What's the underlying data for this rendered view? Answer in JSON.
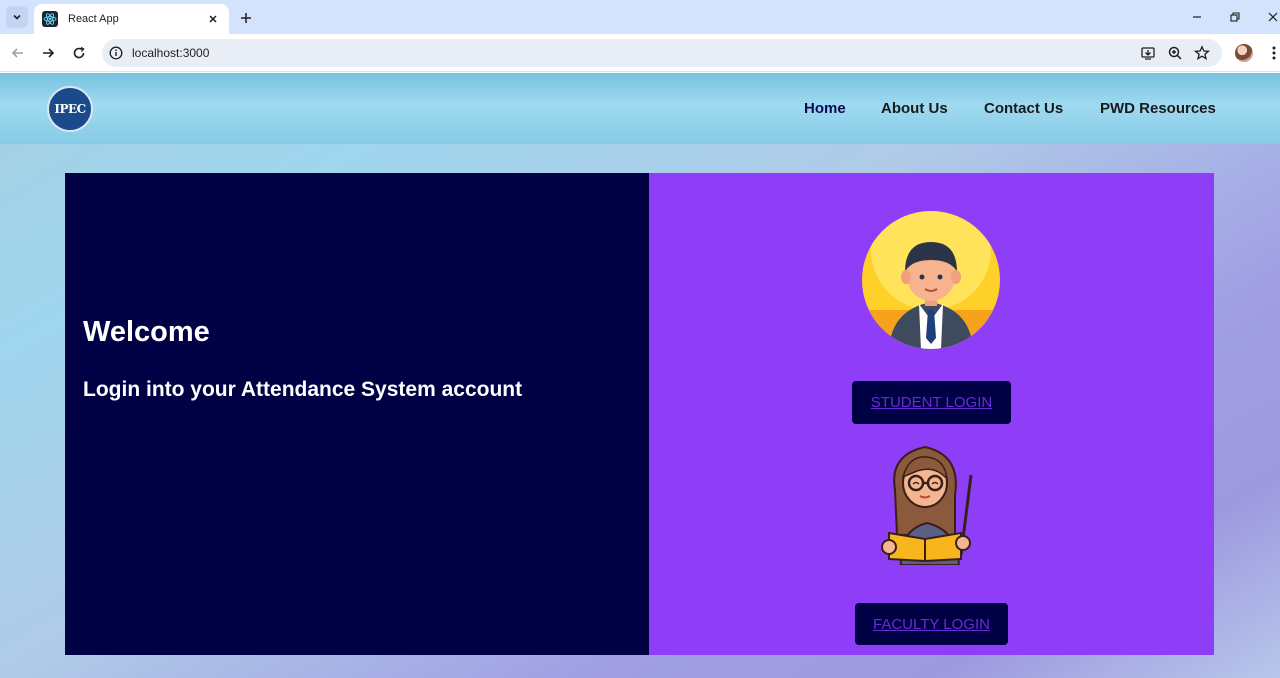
{
  "browser": {
    "tab_title": "React App",
    "url": "localhost:3000"
  },
  "header": {
    "logo_text": "IPEC",
    "nav": [
      {
        "label": "Home"
      },
      {
        "label": "About Us"
      },
      {
        "label": "Contact Us"
      },
      {
        "label": "PWD Resources"
      }
    ]
  },
  "left": {
    "title": "Welcome",
    "subtitle": "Login into your Attendance System account"
  },
  "right": {
    "student_login_label": "STUDENT LOGIN",
    "faculty_login_label": "FACULTY LOGIN"
  },
  "colors": {
    "panel_dark": "#000044",
    "panel_purple": "#8e3ef7",
    "link": "#6a2ad8"
  }
}
